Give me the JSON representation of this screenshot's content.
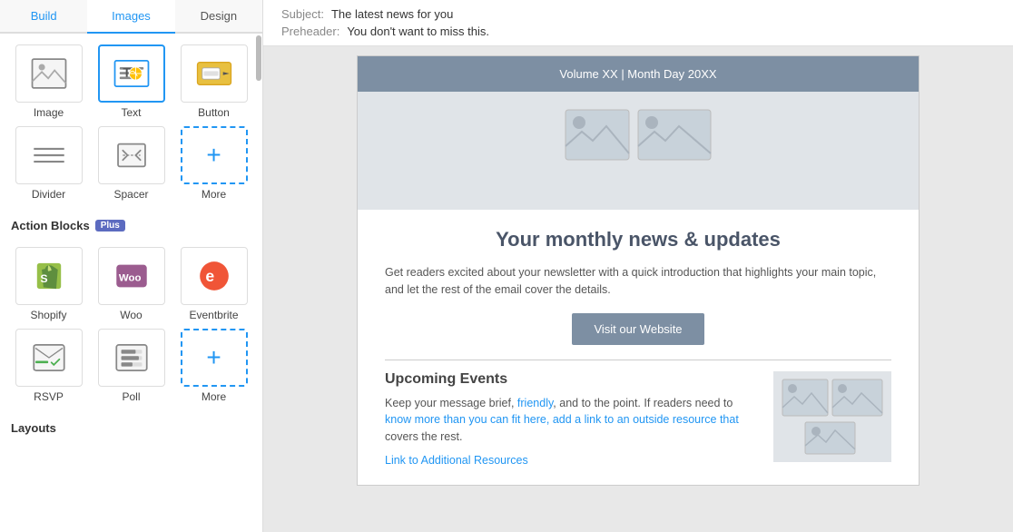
{
  "tabs": [
    {
      "label": "Build",
      "active": false
    },
    {
      "label": "Images",
      "active": true
    },
    {
      "label": "Design",
      "active": false
    }
  ],
  "content_blocks": [
    {
      "id": "image",
      "label": "Image",
      "icon": "image-icon"
    },
    {
      "id": "text",
      "label": "Text",
      "icon": "text-icon",
      "active": true
    },
    {
      "id": "button",
      "label": "Button",
      "icon": "button-icon"
    },
    {
      "id": "divider",
      "label": "Divider",
      "icon": "divider-icon"
    },
    {
      "id": "spacer",
      "label": "Spacer",
      "icon": "spacer-icon"
    },
    {
      "id": "more1",
      "label": "More",
      "icon": "more-icon"
    }
  ],
  "action_blocks_title": "Action Blocks",
  "action_blocks_badge": "Plus",
  "action_blocks": [
    {
      "id": "shopify",
      "label": "Shopify",
      "icon": "shopify-icon"
    },
    {
      "id": "woo",
      "label": "Woo",
      "icon": "woo-icon"
    },
    {
      "id": "eventbrite",
      "label": "Eventbrite",
      "icon": "eventbrite-icon"
    },
    {
      "id": "rsvp",
      "label": "RSVP",
      "icon": "rsvp-icon"
    },
    {
      "id": "poll",
      "label": "Poll",
      "icon": "poll-icon"
    },
    {
      "id": "more2",
      "label": "More",
      "icon": "more-icon2"
    }
  ],
  "layouts_title": "Layouts",
  "meta": {
    "subject_label": "Subject:",
    "subject_value": "The latest news for you",
    "preheader_label": "Preheader:",
    "preheader_value": "You don't want to miss this."
  },
  "email": {
    "header": "Volume XX | Month Day 20XX",
    "headline": "Your monthly news & updates",
    "intro": "Get readers excited about your newsletter with a quick introduction that highlights your main topic, and let the rest of the email cover the details.",
    "cta_label": "Visit our Website",
    "events_title": "Upcoming Events",
    "events_body": "Keep your message brief, friendly, and to the point. If readers need to know more than you can fit here, add a link to an outside resource that covers the rest.",
    "events_link": "Link to Additional Resources"
  }
}
